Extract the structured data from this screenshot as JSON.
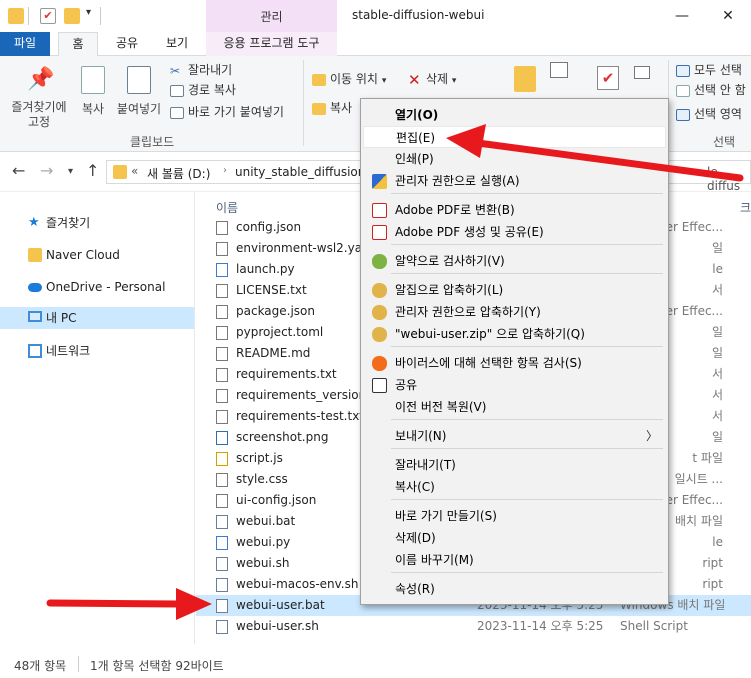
{
  "window": {
    "title": "stable-diffusion-webui",
    "context_tab": "관리",
    "controls": {
      "minimize": "—",
      "maximize": "☐",
      "close": "✕"
    }
  },
  "tabs": [
    {
      "label": "파일"
    },
    {
      "label": "홈"
    },
    {
      "label": "공유"
    },
    {
      "label": "보기"
    },
    {
      "label": "응용 프로그램 도구"
    }
  ],
  "ribbon": {
    "pin_label": "즐겨찾기에\n고정",
    "copy_label": "복사",
    "paste_label": "붙여넣기",
    "cut_label": "잘라내기",
    "copy_path_label": "경로 복사",
    "paste_shortcut_label": "바로 가기 붙여넣기",
    "clipboard_group": "클립보드",
    "move_to_label": "이동 위치",
    "delete_label": "삭제",
    "copy_to_label": "복사",
    "select_all_label": "모두 선택",
    "select_none_label": "선택 안 함",
    "invert_selection_label": "선택 영역",
    "select_group": "선택"
  },
  "addressbar": {
    "chevron": "«",
    "crumbs": [
      "새 볼륨 (D:)",
      "unity_stable_diffusion_w"
    ],
    "overflow_text": "le-diffus"
  },
  "column_header": {
    "name": "이름",
    "extra": "크"
  },
  "sidebar": {
    "items": [
      {
        "label": "즐겨찾기",
        "icon": "star-icon"
      },
      {
        "label": "Naver Cloud",
        "icon": "cloud-folder-icon"
      },
      {
        "label": "OneDrive - Personal",
        "icon": "onedrive-icon"
      },
      {
        "label": "내 PC",
        "icon": "pc-icon"
      },
      {
        "label": "네트워크",
        "icon": "network-icon"
      }
    ]
  },
  "files": [
    {
      "name": "config.json",
      "type": "ter Effec..."
    },
    {
      "name": "environment-wsl2.yaml",
      "type": "일"
    },
    {
      "name": "launch.py",
      "type": "le"
    },
    {
      "name": "LICENSE.txt",
      "type": "서"
    },
    {
      "name": "package.json",
      "type": "ter Effec..."
    },
    {
      "name": "pyproject.toml",
      "type": "일"
    },
    {
      "name": "README.md",
      "type": "일"
    },
    {
      "name": "requirements.txt",
      "type": "서"
    },
    {
      "name": "requirements_versions.txt",
      "type": "서"
    },
    {
      "name": "requirements-test.txt",
      "type": "서"
    },
    {
      "name": "screenshot.png",
      "type": "일"
    },
    {
      "name": "script.js",
      "type": "t 파일"
    },
    {
      "name": "style.css",
      "type": "일시트 ..."
    },
    {
      "name": "ui-config.json",
      "type": "ter Effec..."
    },
    {
      "name": "webui.bat",
      "type": "배치 파일"
    },
    {
      "name": "webui.py",
      "type": "le"
    },
    {
      "name": "webui.sh",
      "type": "ript"
    },
    {
      "name": "webui-macos-env.sh",
      "type": "ript"
    },
    {
      "name": "webui-user.bat",
      "date": "2023-11-14 오후 5:25",
      "type": "Windows 배치 파일"
    },
    {
      "name": "webui-user.sh",
      "date": "2023-11-14 오후 5:25",
      "type": "Shell Script"
    }
  ],
  "context_menu": [
    {
      "label": "열기(O)",
      "bold": true
    },
    {
      "label": "편집(E)"
    },
    {
      "label": "인쇄(P)"
    },
    {
      "label": "관리자 권한으로 실행(A)",
      "icon": "shield-icon"
    },
    {
      "label": "Adobe PDF로 변환(B)",
      "icon": "pdf-icon"
    },
    {
      "label": "Adobe PDF 생성 및 공유(E)",
      "icon": "pdf-share-icon"
    },
    {
      "label": "알약으로 검사하기(V)",
      "icon": "alyac-icon"
    },
    {
      "label": "알집으로 압축하기(L)",
      "icon": "alzip-icon"
    },
    {
      "label": "관리자 권한으로 압축하기(Y)",
      "icon": "alzip-admin-icon"
    },
    {
      "label": "\"webui-user.zip\" 으로 압축하기(Q)",
      "icon": "alzip-zip-icon"
    },
    {
      "label": "바이러스에 대해 선택한 항목 검사(S)",
      "icon": "avast-icon"
    },
    {
      "label": "공유",
      "icon": "share-icon"
    },
    {
      "label": "이전 버전 복원(V)"
    },
    {
      "label": "보내기(N)",
      "arrow": "〉"
    },
    {
      "label": "잘라내기(T)"
    },
    {
      "label": "복사(C)"
    },
    {
      "label": "바로 가기 만들기(S)"
    },
    {
      "label": "삭제(D)"
    },
    {
      "label": "이름 바꾸기(M)"
    },
    {
      "label": "속성(R)"
    }
  ],
  "status": {
    "count": "48개 항목",
    "selected": "1개 항목 선택함 92바이트"
  },
  "colors": {
    "accent": "#1a66b8",
    "selection": "#cce8ff",
    "arrow": "#e8191d"
  }
}
